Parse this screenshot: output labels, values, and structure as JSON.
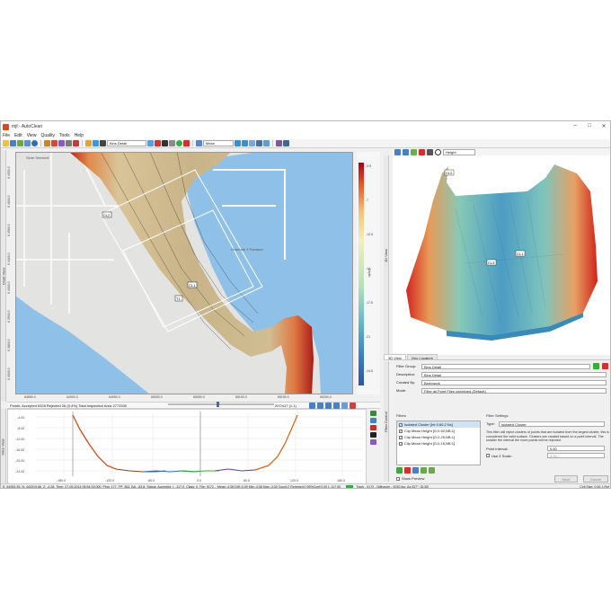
{
  "window": {
    "title": "mjf - AutoClean",
    "minimize": "–",
    "maximize": "□",
    "close": "✕"
  },
  "menu": [
    "File",
    "Edit",
    "View",
    "Quality",
    "Tools",
    "Help"
  ],
  "toolbar": {
    "surface_select": "Bins Detail",
    "stat_select": "Mean",
    "icons": [
      "open-icon",
      "save-icon",
      "add-icon",
      "hand-icon",
      "zoom-icon",
      "select-icon",
      "undo-icon",
      "redo-icon",
      "draw-icon",
      "brush-icon",
      "refresh-icon",
      "delete-icon"
    ]
  },
  "left_tabs": {
    "chart": "Chart View",
    "slice": "Slice View"
  },
  "map": {
    "y_labels": [
      "6 4950.0",
      "6 4600.0",
      "6 4560.0",
      "6 4400.0",
      "6 4000.0",
      "6 3900.0",
      "6 3800.0",
      "6 3000.0"
    ],
    "x_labels": [
      "64850.0",
      "64900.0",
      "64950.0",
      "65000.0",
      "65050.0",
      "65100.0",
      "65150.0",
      "65200.0"
    ],
    "markers": [
      "CL2",
      "CL1",
      "T1"
    ],
    "map_labels": [
      "Slote Semicell",
      "Ovlerude 1\nFormum"
    ]
  },
  "legend": {
    "ticks": [
      "-3.5",
      "-7",
      "-10.5",
      "-14",
      "-17.5",
      "-21",
      "-24.5"
    ],
    "unit": "Depth"
  },
  "status1": {
    "points": "Points: Accepted 6328 Rejected 26 (0.4%) Total Inspection Area 2773330",
    "counter": "207/417 (1.1)"
  },
  "slice": {
    "y_labels": [
      "-4.00",
      "-8.00",
      "-12.00",
      "-16.00",
      "-20.00",
      "-24.00"
    ],
    "x_labels": [
      "-180.0",
      "-120.0",
      "-60.0",
      "0.0",
      "60.0",
      "120.0",
      "180.0"
    ]
  },
  "view3d": {
    "tab_select": "Height",
    "markers": [
      "CL2",
      "CL1",
      "CL3"
    ]
  },
  "tabs": [
    "3D View",
    "Geo Locators"
  ],
  "filter": {
    "filter_group_label": "Filter Group:",
    "filter_group_value": "Bins Detail",
    "description_label": "Description:",
    "description_value": "Bins Detail",
    "created_by_label": "Created By:",
    "created_by_value": "Beenwork",
    "mode_label": "Mode:",
    "mode_value": "Filter all Point Files combined (Default)",
    "filters_title": "Filters",
    "settings_title": "Filter Settings",
    "items": [
      "Isolated Cluster [Int 0.60,2 Nc]",
      "Clip Mean Height [G:0.50,NB:1]",
      "Clip Mean Height [G:0.25,NB:1]",
      "Clip Mean Height [G:0.15,NB:1]"
    ],
    "type_label": "Type:",
    "type_value": "Isolated Cluster",
    "description_text": "This filter will reject clusters of points that are isolated from the largest cluster, this is considered the valid surface. Clusters are created based on a point interval. The smaller the interval the more points will be rejected.",
    "interval_label": "Point Interval:",
    "interval_value": "0.60",
    "zscale_label": "Use Z Scale:",
    "zscale_value": "5.00",
    "show_preview": "Show Preview",
    "save_button": "Save",
    "cancel_button": "Cancel",
    "side_tab": "Filter Control"
  },
  "status2": {
    "left": "E: 64953.35, N: 443319.86, Z: -4.08, Time: 27-05-2014 06:54:33.000, Ping: 177, FP: 363, BA: -83.8, Status: Accepted, I: -117.0, Class: 0, File: 0172 - ;Mean:-4.08  Diff:-0.09  Min:-4.08  Max:-4.00  Count:2  Rejected:0  95%Conf:0.00  I:-117.00",
    "track": "Track - 0172 - Nijlhaven - 0030.fsu; Az:337°; [D:30]",
    "cell": "Cell Size: 0.50,1,Ref"
  },
  "colors": {
    "accent": "#3a6fb8",
    "land": "#e4e4e4",
    "water": "#8fbfe6",
    "shore_red": "#c4281e",
    "bed_tan": "#c9b48c"
  }
}
